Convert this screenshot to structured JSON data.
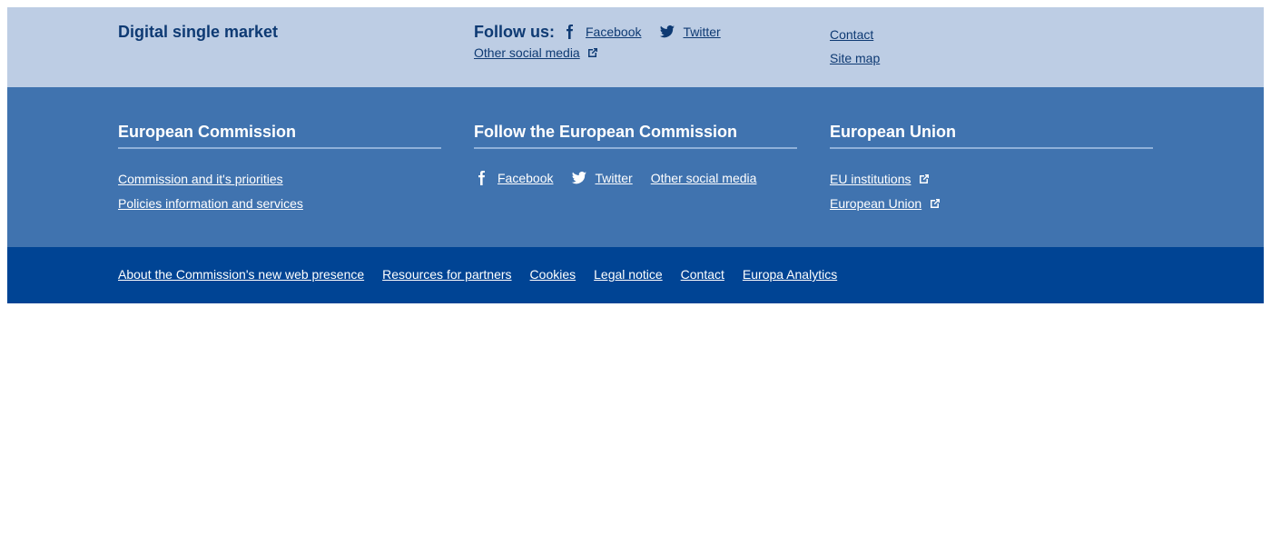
{
  "site": {
    "title": "Digital single market",
    "follow_label": "Follow us:",
    "social": [
      {
        "label": "Facebook",
        "icon": "facebook-icon"
      },
      {
        "label": "Twitter",
        "icon": "twitter-icon"
      }
    ],
    "other_social": "Other social media",
    "links": [
      "Contact",
      "Site map"
    ]
  },
  "corporate": {
    "commission": {
      "heading": "European Commission",
      "links": [
        "Commission and it's priorities",
        "Policies information and services"
      ]
    },
    "follow": {
      "heading": "Follow the European Commission",
      "facebook": "Facebook",
      "twitter": "Twitter",
      "other": "Other social media"
    },
    "eu": {
      "heading": "European Union",
      "links": [
        "EU institutions",
        "European Union"
      ]
    }
  },
  "bottom": {
    "links": [
      "About the Commission's new web presence",
      "Resources for partners",
      "Cookies",
      "Legal notice",
      "Contact",
      "Europa Analytics"
    ]
  },
  "colors": {
    "site_band": "#bdcde4",
    "corp_band": "#4073af",
    "bottom_band": "#004494",
    "site_text": "#0e3a73"
  }
}
